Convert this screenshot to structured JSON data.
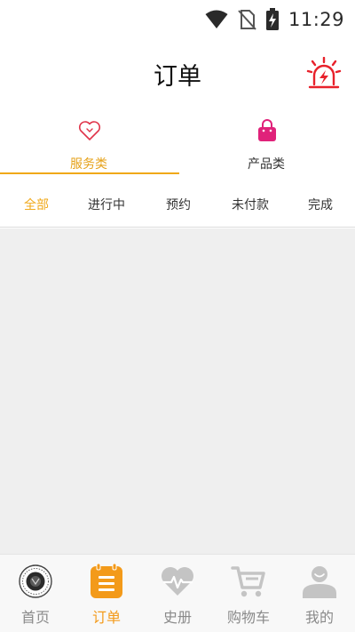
{
  "status_bar": {
    "time": "11:29"
  },
  "header": {
    "title": "订单"
  },
  "categories": [
    {
      "label": "服务类",
      "icon": "heart-outline-icon",
      "active": true
    },
    {
      "label": "产品类",
      "icon": "shopping-bag-icon",
      "active": false
    }
  ],
  "filters": [
    {
      "label": "全部",
      "active": true
    },
    {
      "label": "进行中",
      "active": false
    },
    {
      "label": "预约",
      "active": false
    },
    {
      "label": "未付款",
      "active": false
    },
    {
      "label": "完成",
      "active": false
    }
  ],
  "tabs": [
    {
      "label": "首页",
      "icon": "home-emblem-icon",
      "active": false
    },
    {
      "label": "订单",
      "icon": "order-list-icon",
      "active": true
    },
    {
      "label": "史册",
      "icon": "heart-pulse-icon",
      "active": false
    },
    {
      "label": "购物车",
      "icon": "shopping-cart-icon",
      "active": false
    },
    {
      "label": "我的",
      "icon": "user-profile-icon",
      "active": false
    }
  ],
  "colors": {
    "accent": "#f0a819",
    "alarm": "#e8212b",
    "bag": "#e0227a",
    "content_bg": "#efefef",
    "inactive_icon": "#c4c4c4"
  }
}
